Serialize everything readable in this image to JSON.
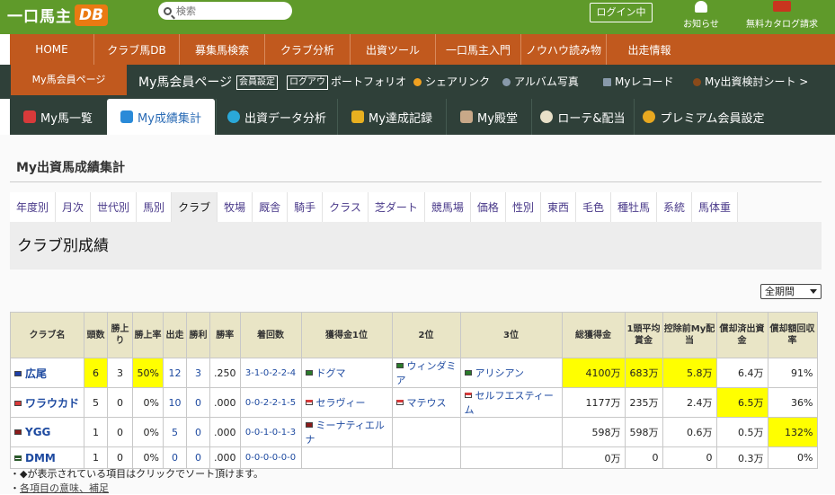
{
  "header": {
    "logo_text": "一口馬主",
    "logo_badge": "DB",
    "search_placeholder": "検索",
    "login_label": "ログイン中",
    "notice_label": "お知らせ",
    "catalog_label": "無料カタログ請求"
  },
  "main_nav": [
    "HOME",
    "クラブ馬DB",
    "募集馬検索",
    "クラブ分析",
    "出資ツール",
    "一口馬主入門",
    "ノウハウ読み物",
    "出走情報"
  ],
  "sub_nav": {
    "mypage_label": "My馬会員ページ",
    "title": "My馬会員ページ",
    "member_settings": "会員設定",
    "logout": "ログアウト",
    "portfolio": "ポートフォリオ",
    "share_link": "シェアリンク",
    "album": "アルバム写真",
    "records": "Myレコード",
    "sheet": "My出資検討シート >"
  },
  "tabs": [
    "My馬一覧",
    "My成績集計",
    "出資データ分析",
    "My達成記録",
    "My殿堂",
    "ローテ&配当",
    "プレミアム会員設定"
  ],
  "active_tab": "My成績集計",
  "page_title": "My出資馬成績集計",
  "sub_tabs": [
    "年度別",
    "月次",
    "世代別",
    "馬別",
    "クラブ",
    "牧場",
    "厩舎",
    "騎手",
    "クラス",
    "芝ダート",
    "競馬場",
    "価格",
    "性別",
    "東西",
    "毛色",
    "種牡馬",
    "系統",
    "馬体重"
  ],
  "active_sub_tab": "クラブ",
  "section_title": "クラブ別成績",
  "period_select": "全期間",
  "table": {
    "headers": [
      "クラブ名",
      "頭数",
      "勝上り",
      "勝上率",
      "出走",
      "勝利",
      "勝率",
      "着回数",
      "獲得金1位",
      "2位",
      "3位",
      "総獲得金",
      "1頭平均賞金",
      "控除前My配当",
      "償却済出資金",
      "償却額回収率"
    ],
    "rows": [
      {
        "club": "広尾",
        "club_color": "#1e3fa8",
        "heads": "6",
        "win_up": "3",
        "win_up_rate": "50%",
        "starts": "12",
        "wins": "3",
        "win_rate": ".250",
        "placings": "3-1-0-2-2-4",
        "top1": "ドグマ",
        "top1_color": "#2a7a2a",
        "top2": "ウィンダミア",
        "top2_color": "#2a7a2a",
        "top3": "アリシアン",
        "top3_color": "#2a7a2a",
        "total": "4100万",
        "avg": "683万",
        "dividend": "5.8万",
        "invested": "6.4万",
        "recovery": "91%"
      },
      {
        "club": "ワラウカド",
        "club_color": "#d83a3a",
        "heads": "5",
        "win_up": "0",
        "win_up_rate": "0%",
        "starts": "10",
        "wins": "0",
        "win_rate": ".000",
        "placings": "0-0-2-2-1-5",
        "top1": "セラヴィー",
        "top1_color": "#d83a3a",
        "top2": "マテウス",
        "top2_color": "#d83a3a",
        "top3": "セルフエスティーム",
        "top3_color": "#d83a3a",
        "total": "1177万",
        "avg": "235万",
        "dividend": "2.4万",
        "invested": "6.5万",
        "recovery": "36%"
      },
      {
        "club": "YGG",
        "club_color": "#8a1a1a",
        "heads": "1",
        "win_up": "0",
        "win_up_rate": "0%",
        "starts": "5",
        "wins": "0",
        "win_rate": ".000",
        "placings": "0-0-1-0-1-3",
        "top1": "ミーナティエルナ",
        "top1_color": "#8a1a1a",
        "top2": "",
        "top2_color": "",
        "top3": "",
        "top3_color": "",
        "total": "598万",
        "avg": "598万",
        "dividend": "0.6万",
        "invested": "0.5万",
        "recovery": "132%"
      },
      {
        "club": "DMM",
        "club_color": "#2a5a2a",
        "heads": "1",
        "win_up": "0",
        "win_up_rate": "0%",
        "starts": "0",
        "wins": "0",
        "win_rate": ".000",
        "placings": "0-0-0-0-0-0",
        "top1": "",
        "top1_color": "",
        "top2": "",
        "top2_color": "",
        "top3": "",
        "top3_color": "",
        "total": "0万",
        "avg": "0",
        "dividend": "0",
        "invested": "0.3万",
        "recovery": "0%"
      }
    ]
  },
  "footnotes": {
    "note1": "・◆が表示されている項目はクリックでソート頂けます。",
    "note2_prefix": "・",
    "note2_link": "各項目の意味、補足"
  }
}
